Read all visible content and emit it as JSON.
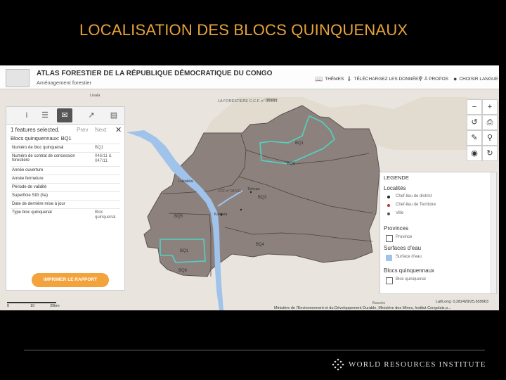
{
  "slide": {
    "title": "LOCALISATION DES BLOCS QUINQUENAUX",
    "footer_org": "WORLD RESOURCES INSTITUTE"
  },
  "app": {
    "title": "ATLAS FORESTIER DE LA RÉPUBLIQUE DÉMOCRATIQUE DU CONGO",
    "subtitle": "Aménagement forestier",
    "nav": [
      {
        "icon": "book-icon",
        "label": "THÈMES"
      },
      {
        "icon": "download-icon",
        "label": "TÉLÉCHARGEZ LES DONNÉES"
      },
      {
        "icon": "help-icon",
        "label": "À PROPOS"
      },
      {
        "icon": "comment-icon",
        "label": "CHOISIR LANGUE"
      }
    ]
  },
  "panel": {
    "features_selected": "1 features selected.",
    "prev": "Prev",
    "next": "Next",
    "layer_title": "Blocs quinquennaux: BQ1",
    "rows": [
      {
        "key": "Numéro de bloc quinquenal",
        "value": "BQ1"
      },
      {
        "key": "Numéro de contrat de concession forestière",
        "value": "046/11 & 047/11"
      },
      {
        "key": "Année ouverture",
        "value": ""
      },
      {
        "key": "Année fermeture",
        "value": ""
      },
      {
        "key": "Période de validité",
        "value": ""
      },
      {
        "key": "Superficie SIG (ha)",
        "value": ""
      },
      {
        "key": "Date de dernière mise à jour",
        "value": ""
      },
      {
        "key": "Type bloc quinquenal",
        "value": "Bloc quinquenal"
      }
    ],
    "print_label": "IMPRIMER LE RAPPORT"
  },
  "legend": {
    "title": "LEGENDE",
    "sections": [
      {
        "heading": "Localités",
        "items": [
          "Chef-lieu de district",
          "Chef-lieu de Territoire",
          "Ville"
        ]
      },
      {
        "heading": "Provinces",
        "items": [
          "Province"
        ]
      },
      {
        "heading": "Surfaces d'eau",
        "items": [
          "Surface d'eau"
        ]
      },
      {
        "heading": "Blocs quinquennaux",
        "items": [
          "Bloc quinquenal"
        ]
      }
    ]
  },
  "map": {
    "labels": {
      "bq1_top": "BQ1",
      "bq2": "BQ2",
      "bq3": "BQ3",
      "bq4": "BQ4",
      "bq5": "BQ5",
      "bq1_bottom": "BQ1",
      "bq6": "BQ6",
      "forestiere": "LA FORESTIERE C.C.F. n° 003/11",
      "lisala": "Lisala",
      "ishopo": "Ishopo",
      "lukolela": "Lukolela",
      "tshopo": "Tshopo",
      "ccf": "CCF n° 047/11",
      "kabinda": "Kabinda",
      "basoko": "Basoko"
    },
    "latlong": "Lat/Long: 0,282429/25,659963",
    "ministry": "Ministère de l'Environnement et du Développement Durable, Ministère des Mines, Institut Congolais p...",
    "scale": {
      "zero": "0",
      "ten": "10",
      "twenty": "20km"
    }
  },
  "colors": {
    "title": "#e8a33a",
    "concession_fill": "#8d817d",
    "bloc_outline": "#4fd3c4",
    "river": "#9fc3ea",
    "print_button": "#f2a33c"
  }
}
